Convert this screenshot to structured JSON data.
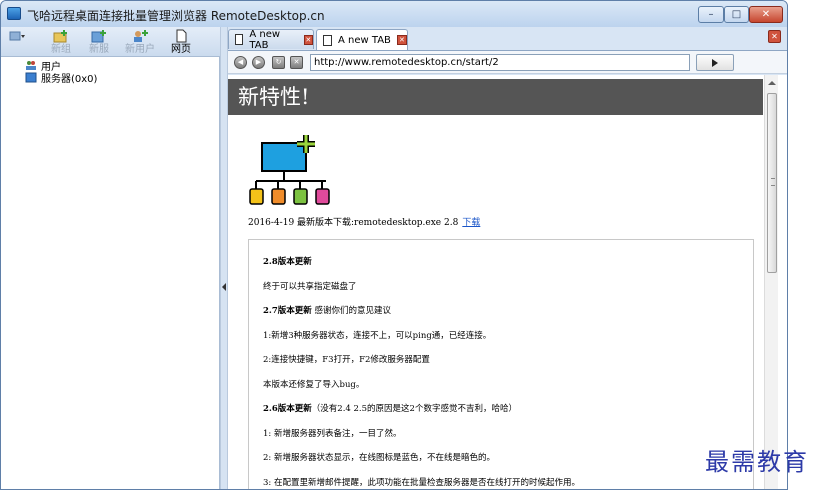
{
  "window": {
    "title": "飞哈远程桌面连接批量管理浏览器 RemoteDesktop.cn",
    "controls": {
      "minimize": "–",
      "maximize": "□",
      "close": "✕"
    }
  },
  "left_toolbar": {
    "items": [
      {
        "label": "新组",
        "icon": "folder-plus-icon"
      },
      {
        "label": "新服",
        "icon": "server-plus-icon"
      },
      {
        "label": "新用户",
        "icon": "user-plus-icon"
      },
      {
        "label": "网页",
        "icon": "page-icon"
      }
    ]
  },
  "tree": {
    "items": [
      {
        "label": "用户",
        "icon": "users-icon"
      },
      {
        "label": "服务器(0x0)",
        "icon": "server-icon"
      }
    ]
  },
  "tabs": [
    {
      "label": "A new TAB",
      "active": false
    },
    {
      "label": "A new TAB",
      "active": true
    }
  ],
  "navbar": {
    "url": "http://www.remotedesktop.cn/start/2"
  },
  "page": {
    "banner": "新特性!",
    "release_date": "2016-4-19 最新版本下载:remotedesktop.exe 2.8",
    "download_link": "下载",
    "notes": [
      {
        "bold": "2.8版本更新",
        "text": ""
      },
      {
        "bold": "",
        "text": "终于可以共享指定磁盘了"
      },
      {
        "bold": "2.7版本更新",
        "text": " 感谢你们的意见建议"
      },
      {
        "bold": "",
        "text": "1:新增3种服务器状态，连接不上，可以ping通，已经连接。"
      },
      {
        "bold": "",
        "text": "2:连接快捷键，F3打开，F2修改服务器配置"
      },
      {
        "bold": "",
        "text": "本版本还修复了导入bug。"
      },
      {
        "bold": "2.6版本更新",
        "text": "（没有2.4 2.5的原因是这2个数字感觉不吉利，哈哈）"
      },
      {
        "bold": "",
        "text": "1:   新增服务器列表备注，一目了然。"
      },
      {
        "bold": "",
        "text": "2:   新增服务器状态显示，在线图标是蓝色，不在线是暗色的。"
      },
      {
        "bold": "",
        "text": "3: 在配置里新增邮件提醒，此项功能在批量检查服务器是否在线打开的时候起作用。"
      }
    ]
  },
  "watermark": "最需教育",
  "colors": {
    "banner": "#555555",
    "link": "#1a55c8",
    "window_frame": "#cfe0f3"
  }
}
